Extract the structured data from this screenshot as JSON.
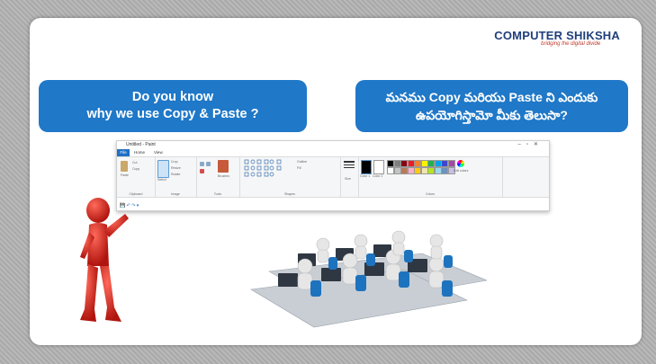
{
  "logo": {
    "name": "COMPUTER SHIKSHA",
    "tagline": "bridging the digital divide"
  },
  "banner_left": {
    "line1": "Do you know",
    "line2": "why we use Copy & Paste ?"
  },
  "banner_right": {
    "line1": "మనము Copy మరియు Paste ని ఎందుకు",
    "line2": "ఉపయోగిస్తామో మీకు తెలుసా?"
  },
  "paint": {
    "title": "Untitled - Paint",
    "tabs": [
      "File",
      "Home",
      "View"
    ],
    "groups": [
      "Clipboard",
      "Image",
      "Tools",
      "Shapes",
      "Colors"
    ],
    "buttons": {
      "paste": "Paste",
      "cut": "Cut",
      "copy": "Copy",
      "select": "Select",
      "crop": "Crop",
      "resize": "Resize",
      "rotate": "Rotate",
      "brushes": "Brushes",
      "size": "Size",
      "color1": "Color 1",
      "color2": "Color 2",
      "edit_colors": "Edit colors",
      "outline": "Outline",
      "fill": "Fill"
    },
    "palette": [
      "#000000",
      "#7f7f7f",
      "#880015",
      "#ed1c24",
      "#ff7f27",
      "#fff200",
      "#22b14c",
      "#00a2e8",
      "#3f48cc",
      "#a349a4",
      "#ffffff",
      "#c3c3c3",
      "#b97a57",
      "#ffaec9",
      "#ffc90e",
      "#efe4b0",
      "#b5e61d",
      "#99d9ea",
      "#7092be",
      "#c8bfe7"
    ]
  }
}
